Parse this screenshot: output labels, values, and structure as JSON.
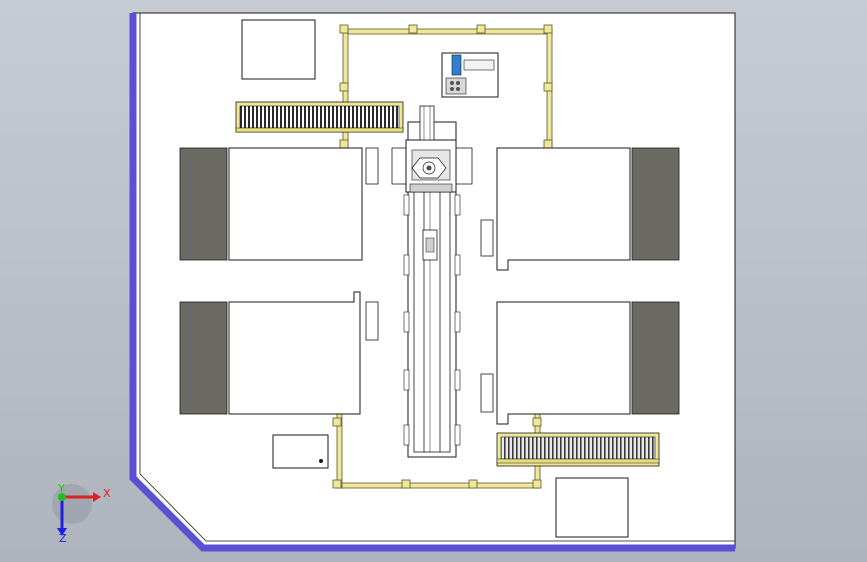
{
  "viewport": {
    "background_top": "#c7ccd4",
    "background_bottom": "#aeb4bd",
    "floor_fill": "#ffffff",
    "wall_color": "#5b4fd6",
    "frame_color": "#efe79a",
    "frame_outline": "#5a5a2a",
    "pad_color": "#6b6b63",
    "line_color": "#1a1a1a"
  },
  "triad": {
    "x_label": "X",
    "y_label": "Y",
    "z_label": "Z",
    "x_color": "#e02020",
    "y_color": "#20c020",
    "z_color": "#2020e0"
  },
  "components": {
    "machine_tools": 4,
    "roller_conveyors": 2,
    "gantry_rail": 1,
    "control_cabinets": 2,
    "electrical_box": 1,
    "robot_head": 1
  }
}
